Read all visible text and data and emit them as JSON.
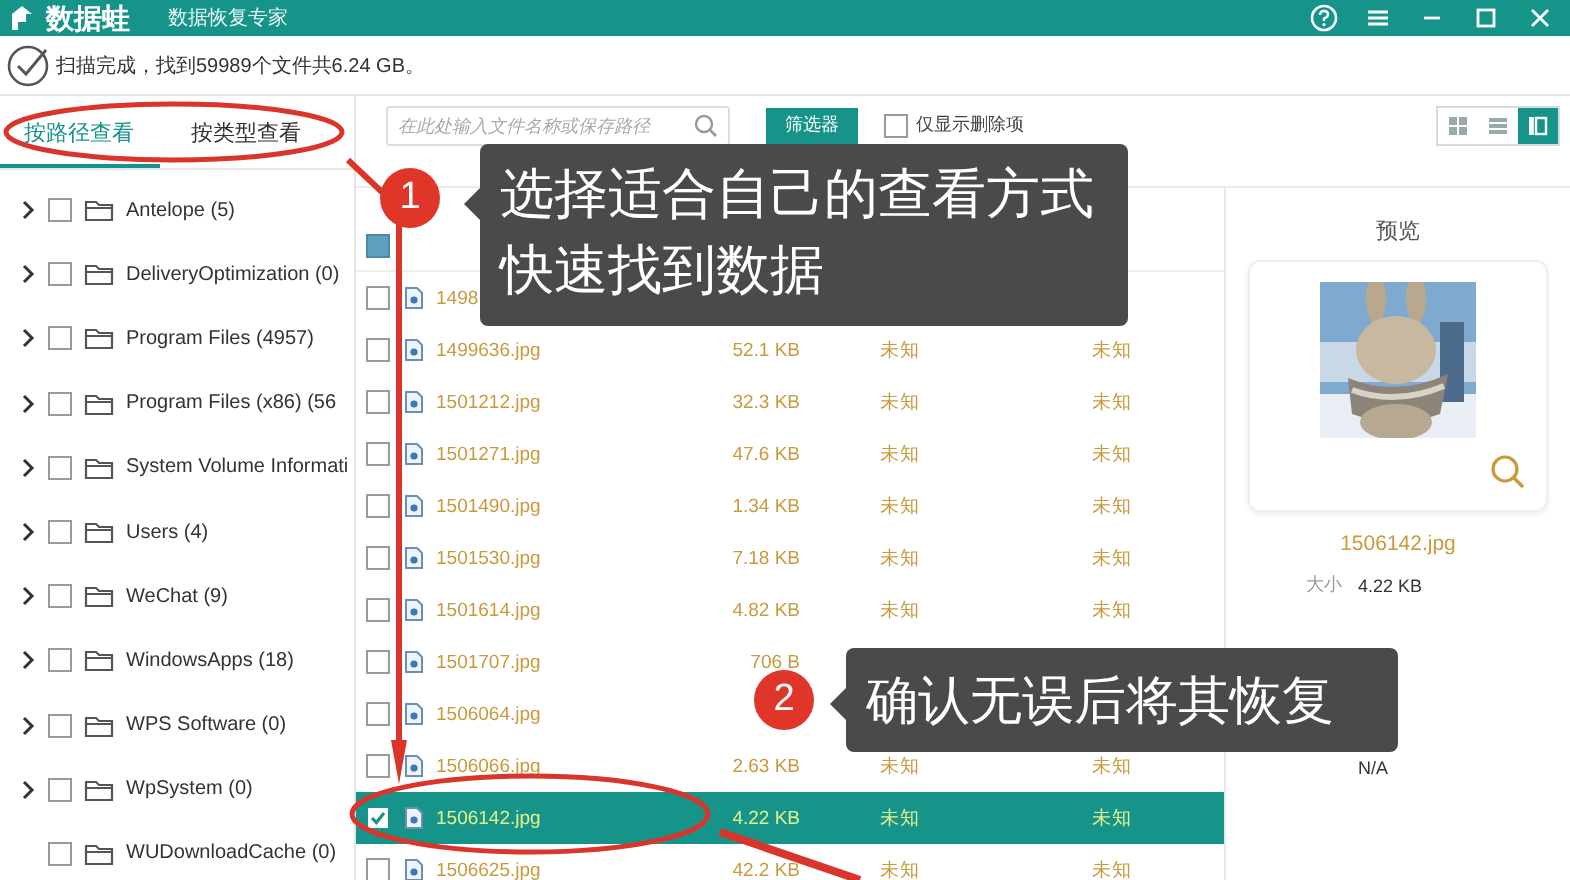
{
  "window": {
    "title": "数据蛙",
    "subtitle": "数据恢复专家"
  },
  "status": {
    "message": "扫描完成，找到59989个文件共6.24 GB。"
  },
  "view_tabs": [
    {
      "label": "按路径查看",
      "selected": true
    },
    {
      "label": "按类型查看",
      "selected": false
    }
  ],
  "tree": [
    {
      "label": "Antelope (5)",
      "checked": false,
      "expandable": true
    },
    {
      "label": "DeliveryOptimization (0)",
      "checked": false,
      "expandable": true
    },
    {
      "label": "Program Files (4957)",
      "checked": false,
      "expandable": true
    },
    {
      "label": "Program Files (x86) (56",
      "checked": false,
      "expandable": true
    },
    {
      "label": "System Volume Informati",
      "checked": false,
      "expandable": true
    },
    {
      "label": "Users (4)",
      "checked": false,
      "expandable": true
    },
    {
      "label": "WeChat (9)",
      "checked": false,
      "expandable": true
    },
    {
      "label": "WindowsApps (18)",
      "checked": false,
      "expandable": true
    },
    {
      "label": "WPS Software (0)",
      "checked": false,
      "expandable": true
    },
    {
      "label": "WpSystem (0)",
      "checked": false,
      "expandable": true
    },
    {
      "label": "WUDownloadCache (0)",
      "checked": false,
      "expandable": false
    }
  ],
  "toolbar": {
    "search": {
      "placeholder": "在此处输入文件名称或保存路径"
    },
    "filter_button": "筛选器",
    "deleted_only": {
      "label": "仅显示删除项",
      "checked": false
    },
    "views": [
      {
        "kind": "grid",
        "selected": false
      },
      {
        "kind": "list",
        "selected": false
      },
      {
        "kind": "detail",
        "selected": true
      }
    ]
  },
  "table": {
    "select_all": {
      "indeterminate": true
    },
    "rows": [
      {
        "name": "1498",
        "checked": false,
        "selected": false
      },
      {
        "name": "1499636.jpg",
        "size": "52.1 KB",
        "created": "未知",
        "modified": "未知",
        "checked": false,
        "selected": false
      },
      {
        "name": "1501212.jpg",
        "size": "32.3 KB",
        "created": "未知",
        "modified": "未知",
        "checked": false,
        "selected": false
      },
      {
        "name": "1501271.jpg",
        "size": "47.6 KB",
        "created": "未知",
        "modified": "未知",
        "checked": false,
        "selected": false
      },
      {
        "name": "1501490.jpg",
        "size": "1.34 KB",
        "created": "未知",
        "modified": "未知",
        "checked": false,
        "selected": false
      },
      {
        "name": "1501530.jpg",
        "size": "7.18 KB",
        "created": "未知",
        "modified": "未知",
        "checked": false,
        "selected": false
      },
      {
        "name": "1501614.jpg",
        "size": "4.82 KB",
        "created": "未知",
        "modified": "未知",
        "checked": false,
        "selected": false
      },
      {
        "name": "1501707.jpg",
        "size": "706 B",
        "checked": false,
        "selected": false
      },
      {
        "name": "1506064.jpg",
        "checked": false,
        "selected": false
      },
      {
        "name": "1506066.jpg",
        "size": "2.63 KB",
        "created": "未知",
        "modified": "未知",
        "checked": false,
        "selected": false
      },
      {
        "name": "1506142.jpg",
        "size": "4.22 KB",
        "created": "未知",
        "modified": "未知",
        "checked": true,
        "selected": true
      },
      {
        "name": "1506625.jpg",
        "size": "42.2 KB",
        "created": "未知",
        "modified": "未知",
        "checked": false,
        "selected": false
      }
    ]
  },
  "preview": {
    "title": "预览",
    "file_name": "1506142.jpg",
    "details": [
      {
        "label": "大小",
        "value": "4.22 KB"
      },
      {
        "value": "N/A"
      }
    ]
  },
  "callouts": [
    {
      "number": "1",
      "lines": [
        "选择适合自己的查看方式",
        "快速找到数据"
      ]
    },
    {
      "number": "2",
      "lines": [
        "确认无误后将其恢复"
      ]
    }
  ]
}
